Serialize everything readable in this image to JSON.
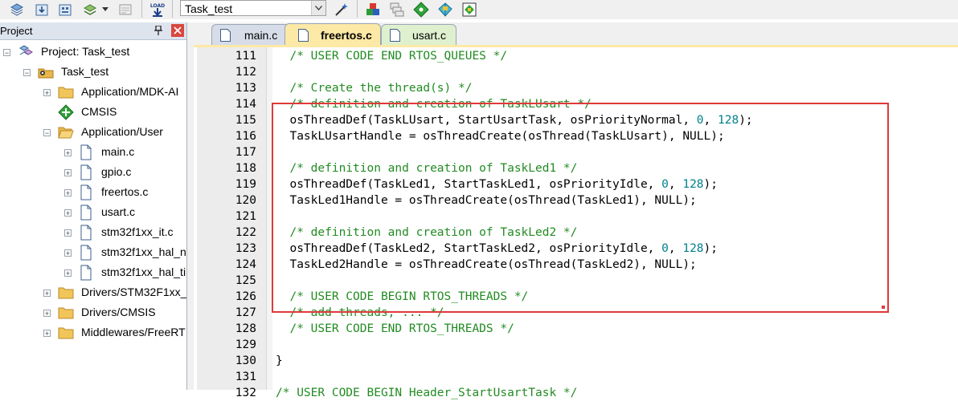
{
  "toolbar": {
    "target_select": "Task_test",
    "buttons": [
      "stack-icon",
      "download-icon",
      "batch-icon",
      "layers-icon",
      "translate-icon",
      "load-icon",
      "magic-wand-icon",
      "component-icon",
      "windows-icon",
      "diamond-icon",
      "pack-icon",
      "pack-installer-icon"
    ],
    "load_icon_text": "LOAD"
  },
  "project_panel": {
    "title": "Project",
    "pin_glyph": "⍐",
    "close_glyph": "×",
    "tree": [
      {
        "label": "Project: Task_test",
        "icon": "project-icon",
        "level": 0,
        "expander": "−"
      },
      {
        "label": "Task_test",
        "icon": "target-folder-icon",
        "level": 1,
        "expander": "−"
      },
      {
        "label": "Application/MDK-AI",
        "icon": "folder-icon",
        "level": 2,
        "expander": "+"
      },
      {
        "label": "CMSIS",
        "icon": "green-diamond-icon",
        "level": 2,
        "expander": ""
      },
      {
        "label": "Application/User",
        "icon": "open-folder-icon",
        "level": 2,
        "expander": "−"
      },
      {
        "label": "main.c",
        "icon": "file-icon",
        "level": 3,
        "expander": "+"
      },
      {
        "label": "gpio.c",
        "icon": "file-icon",
        "level": 3,
        "expander": "+"
      },
      {
        "label": "freertos.c",
        "icon": "file-icon",
        "level": 3,
        "expander": "+"
      },
      {
        "label": "usart.c",
        "icon": "file-icon",
        "level": 3,
        "expander": "+"
      },
      {
        "label": "stm32f1xx_it.c",
        "icon": "file-icon",
        "level": 3,
        "expander": "+"
      },
      {
        "label": "stm32f1xx_hal_n",
        "icon": "file-icon",
        "level": 3,
        "expander": "+"
      },
      {
        "label": "stm32f1xx_hal_ti",
        "icon": "file-icon",
        "level": 3,
        "expander": "+"
      },
      {
        "label": "Drivers/STM32F1xx_",
        "icon": "folder-icon",
        "level": 2,
        "expander": "+"
      },
      {
        "label": "Drivers/CMSIS",
        "icon": "folder-icon",
        "level": 2,
        "expander": "+"
      },
      {
        "label": "Middlewares/FreeRT",
        "icon": "folder-icon",
        "level": 2,
        "expander": "+"
      }
    ]
  },
  "tabs": [
    {
      "label": "main.c",
      "state": "inactive"
    },
    {
      "label": "freertos.c",
      "state": "active"
    },
    {
      "label": "usart.c",
      "state": "green"
    }
  ],
  "editor": {
    "lines": [
      {
        "n": "111",
        "parts": [
          {
            "t": "  "
          },
          {
            "t": "/* USER CODE END RTOS_QUEUES */",
            "c": "cm"
          }
        ]
      },
      {
        "n": "112",
        "parts": [
          {
            "t": ""
          }
        ]
      },
      {
        "n": "113",
        "parts": [
          {
            "t": "  "
          },
          {
            "t": "/* Create the thread(s) */",
            "c": "cm"
          }
        ]
      },
      {
        "n": "114",
        "parts": [
          {
            "t": "  "
          },
          {
            "t": "/* definition and creation of TaskLUsart */",
            "c": "cm"
          }
        ]
      },
      {
        "n": "115",
        "parts": [
          {
            "t": "  osThreadDef(TaskLUsart, StartUsartTask, osPriorityNormal, "
          },
          {
            "t": "0",
            "c": "num"
          },
          {
            "t": ", "
          },
          {
            "t": "128",
            "c": "num"
          },
          {
            "t": ");"
          }
        ]
      },
      {
        "n": "116",
        "parts": [
          {
            "t": "  TaskLUsartHandle = osThreadCreate(osThread(TaskLUsart), NULL);"
          }
        ]
      },
      {
        "n": "117",
        "parts": [
          {
            "t": ""
          }
        ]
      },
      {
        "n": "118",
        "parts": [
          {
            "t": "  "
          },
          {
            "t": "/* definition and creation of TaskLed1 */",
            "c": "cm"
          }
        ]
      },
      {
        "n": "119",
        "parts": [
          {
            "t": "  osThreadDef(TaskLed1, StartTaskLed1, osPriorityIdle, "
          },
          {
            "t": "0",
            "c": "num"
          },
          {
            "t": ", "
          },
          {
            "t": "128",
            "c": "num"
          },
          {
            "t": ");"
          }
        ]
      },
      {
        "n": "120",
        "parts": [
          {
            "t": "  TaskLed1Handle = osThreadCreate(osThread(TaskLed1), NULL);"
          }
        ]
      },
      {
        "n": "121",
        "parts": [
          {
            "t": ""
          }
        ]
      },
      {
        "n": "122",
        "parts": [
          {
            "t": "  "
          },
          {
            "t": "/* definition and creation of TaskLed2 */",
            "c": "cm"
          }
        ]
      },
      {
        "n": "123",
        "parts": [
          {
            "t": "  osThreadDef(TaskLed2, StartTaskLed2, osPriorityIdle, "
          },
          {
            "t": "0",
            "c": "num"
          },
          {
            "t": ", "
          },
          {
            "t": "128",
            "c": "num"
          },
          {
            "t": ");"
          }
        ]
      },
      {
        "n": "124",
        "parts": [
          {
            "t": "  TaskLed2Handle = osThreadCreate(osThread(TaskLed2), NULL);"
          }
        ]
      },
      {
        "n": "125",
        "parts": [
          {
            "t": ""
          }
        ]
      },
      {
        "n": "126",
        "parts": [
          {
            "t": "  "
          },
          {
            "t": "/* USER CODE BEGIN RTOS_THREADS */",
            "c": "cm"
          }
        ]
      },
      {
        "n": "127",
        "parts": [
          {
            "t": "  "
          },
          {
            "t": "/* add threads, ... */",
            "c": "cm"
          }
        ]
      },
      {
        "n": "128",
        "parts": [
          {
            "t": "  "
          },
          {
            "t": "/* USER CODE END RTOS_THREADS */",
            "c": "cm"
          }
        ]
      },
      {
        "n": "129",
        "parts": [
          {
            "t": ""
          }
        ]
      },
      {
        "n": "130",
        "parts": [
          {
            "t": "}"
          }
        ]
      },
      {
        "n": "131",
        "parts": [
          {
            "t": ""
          }
        ]
      },
      {
        "n": "132",
        "parts": [
          {
            "t": "/* USER CODE BEGIN Header_StartUsartTask */",
            "c": "cm"
          }
        ]
      }
    ],
    "colors": {
      "comment": "#228b22",
      "number": "#00808c",
      "highlight_box": "#e0393a"
    }
  }
}
